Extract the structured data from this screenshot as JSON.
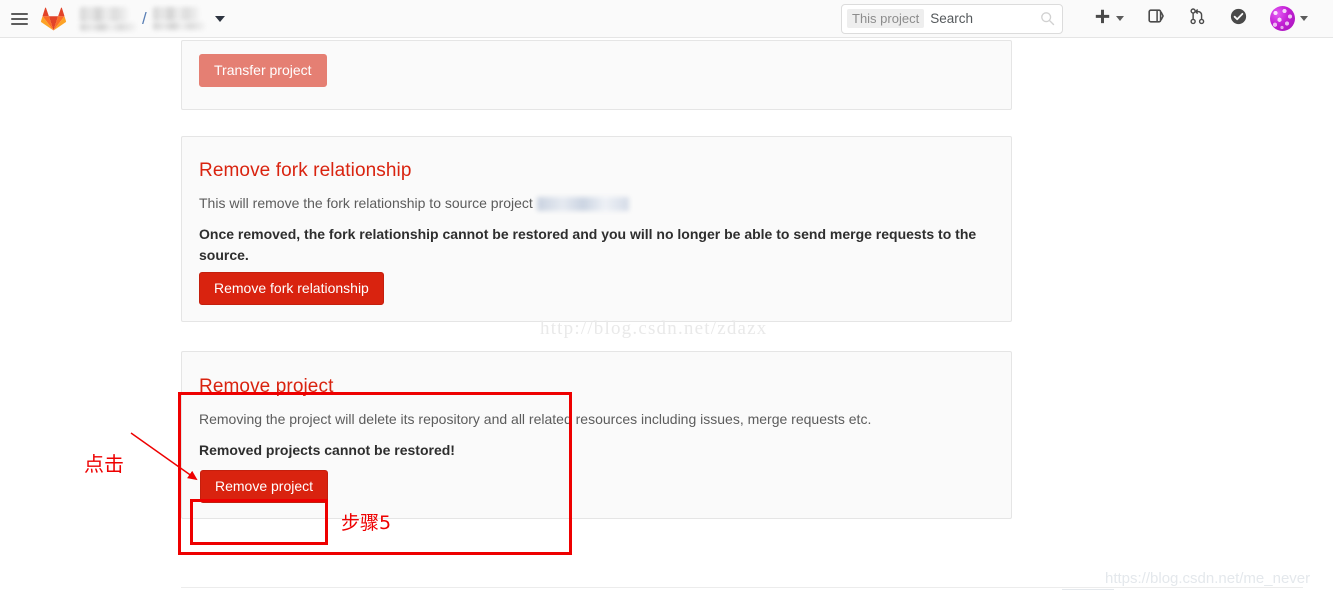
{
  "header": {
    "menu_icon": "hamburger-icon",
    "logo": "gitlab-logo",
    "breadcrumb": {
      "group_redacted": true,
      "separator": "/",
      "project_redacted": true,
      "dropdown_icon": "chevron-down-icon"
    },
    "search": {
      "scope_label": "This project",
      "placeholder": "Search",
      "value": "",
      "icon": "search-icon"
    },
    "actions": [
      {
        "name": "new-dropdown",
        "icon": "plus-icon",
        "has_caret": true
      },
      {
        "name": "issue-boards",
        "icon": "board-icon",
        "has_caret": false
      },
      {
        "name": "merge-requests",
        "icon": "merge-request-icon",
        "has_caret": false
      },
      {
        "name": "todos",
        "icon": "check-circle-icon",
        "has_caret": false
      },
      {
        "name": "user-menu",
        "icon": "avatar",
        "has_caret": true
      }
    ]
  },
  "panels": {
    "transfer": {
      "button_label": "Transfer project"
    },
    "fork": {
      "title": "Remove fork relationship",
      "description_prefix": "This will remove the fork relationship to source project",
      "source_project_redacted": true,
      "warning": "Once removed, the fork relationship cannot be restored and you will no longer be able to send merge requests to the source.",
      "button_label": "Remove fork relationship"
    },
    "remove": {
      "title": "Remove project",
      "description": "Removing the project will delete its repository and all related resources including issues, merge requests etc.",
      "warning": "Removed projects cannot be restored!",
      "button_label": "Remove project"
    }
  },
  "annotations": {
    "click_label": "点击",
    "step_label": "步骤5",
    "color": "#ee0000",
    "arrow": "points from 点击 label to Remove project button"
  },
  "watermarks": {
    "center": "http://blog.csdn.net/zdazx",
    "bottom_right": "https://blog.csdn.net/me_never"
  },
  "colors": {
    "danger": "#d9230f",
    "danger_muted": "#e57f73",
    "heading": "#d9230f",
    "panel_bg": "#fafafa",
    "panel_border": "#e5e5e5",
    "annotation": "#ee0000"
  }
}
